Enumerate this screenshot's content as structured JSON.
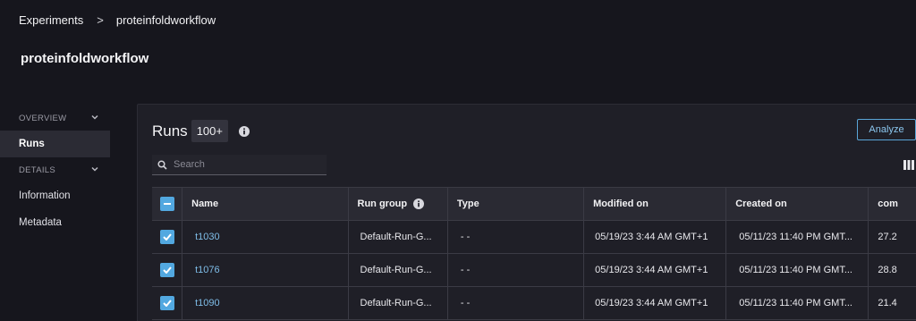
{
  "breadcrumb": {
    "items": [
      "Experiments",
      "proteinfoldworkflow"
    ],
    "separator": ">"
  },
  "page": {
    "title": "proteinfoldworkflow"
  },
  "sidebar": {
    "sections": [
      {
        "label": "OVERVIEW",
        "items": [
          "Runs"
        ]
      },
      {
        "label": "DETAILS",
        "items": [
          "Information",
          "Metadata"
        ]
      }
    ],
    "active": "Runs"
  },
  "runs": {
    "title": "Runs",
    "count": "100+",
    "analyze_label": "Analyze",
    "search_placeholder": "Search",
    "columns": [
      "Name",
      "Run group",
      "Type",
      "Modified on",
      "Created on",
      "com"
    ],
    "rows": [
      {
        "name": "t1030",
        "run_group": "Default-Run-G...",
        "type": "- -",
        "modified": "05/19/23 3:44 AM GMT+1",
        "created": "05/11/23 11:40 PM GMT...",
        "com": "27.2"
      },
      {
        "name": "t1076",
        "run_group": "Default-Run-G...",
        "type": "- -",
        "modified": "05/19/23 3:44 AM GMT+1",
        "created": "05/11/23 11:40 PM GMT...",
        "com": "28.8"
      },
      {
        "name": "t1090",
        "run_group": "Default-Run-G...",
        "type": "- -",
        "modified": "05/19/23 3:44 AM GMT+1",
        "created": "05/11/23 11:40 PM GMT...",
        "com": "21.4"
      }
    ]
  },
  "colors": {
    "accent": "#52a8e0",
    "link": "#7fbde8",
    "background": "#16161d",
    "panel": "#1f1f27"
  }
}
